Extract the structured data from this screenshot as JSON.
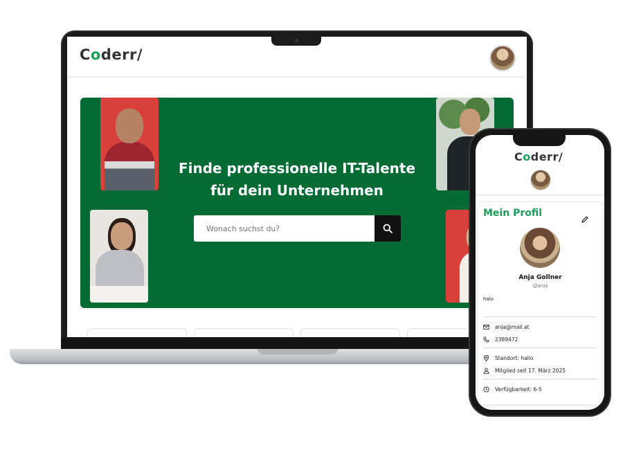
{
  "brand": {
    "logo_prefix": "C",
    "logo_o": "o",
    "logo_suffix": "derr/",
    "accent_color": "#1a9e5a",
    "hero_color": "#046b34"
  },
  "laptop": {
    "hero": {
      "title_line1": "Finde professionelle IT-Talente",
      "title_line2": "für dein Unternehmen",
      "search_placeholder": "Wonach suchst du?"
    }
  },
  "phone": {
    "profile": {
      "heading": "Mein Profil",
      "name": "Anja Gollner",
      "username": "@anja",
      "bio": "halo",
      "email": "anja@mail.at",
      "phone": "2389472",
      "location": "Standort: hallo",
      "member_since": "Mitglied seit 17. März 2025",
      "availability": "Verfügbarkeit: 6-5"
    }
  },
  "icons": [
    "search-icon",
    "edit-icon",
    "mail-icon",
    "phone-icon",
    "location-icon",
    "user-icon",
    "clock-icon"
  ]
}
